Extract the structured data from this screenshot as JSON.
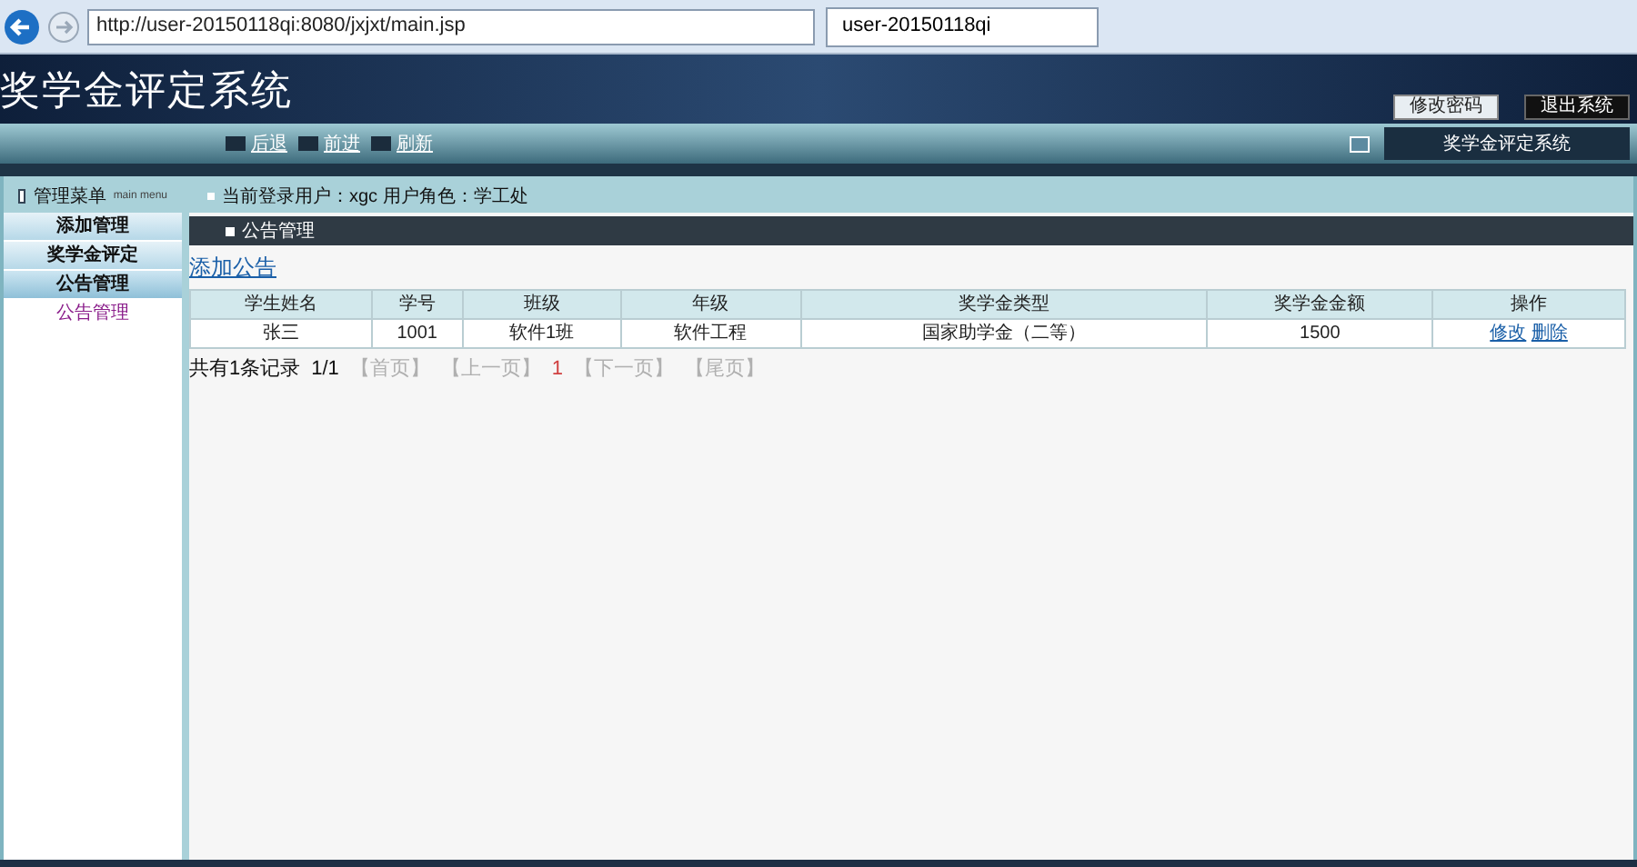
{
  "browser": {
    "address": "http://user-20150118qi:8080/jxjxt/main.jsp",
    "tab_title": "user-20150118qi"
  },
  "header": {
    "title": "奖学金评定系统",
    "buttons": [
      "修改密码",
      "退出系统"
    ]
  },
  "nav": {
    "items": [
      "后退",
      "前进",
      "刷新"
    ],
    "system_button": "奖学金评定系统"
  },
  "sidebar": {
    "title": "管理菜单",
    "subtitle": "main menu",
    "items": [
      {
        "label": "添加管理",
        "kind": "group",
        "selected": false
      },
      {
        "label": "奖学金评定",
        "kind": "group",
        "selected": false
      },
      {
        "label": "公告管理",
        "kind": "group",
        "selected": true
      },
      {
        "label": "公告管理",
        "kind": "link",
        "selected": false
      }
    ]
  },
  "user_info": "当前登录用户：xgc 用户角色：学工处",
  "section_title": "公告管理",
  "add_link": "添加公告",
  "table": {
    "columns": [
      "学生姓名",
      "学号",
      "班级",
      "年级",
      "奖学金类型",
      "奖学金金额",
      "操作"
    ],
    "rows": [
      {
        "cells": [
          "张三",
          "1001",
          "软件1班",
          "软件工程",
          "国家助学金（二等）",
          "1500"
        ],
        "actions": [
          "修改",
          "删除"
        ]
      }
    ]
  },
  "pagination": {
    "summary": "共有1条记录",
    "page": "1/1",
    "links": [
      {
        "label": "【首页】",
        "disabled": true
      },
      {
        "label": "【上一页】",
        "disabled": true
      },
      {
        "label": "1",
        "disabled": false
      },
      {
        "label": "【下一页】",
        "disabled": true
      },
      {
        "label": "【尾页】",
        "disabled": true
      }
    ]
  }
}
